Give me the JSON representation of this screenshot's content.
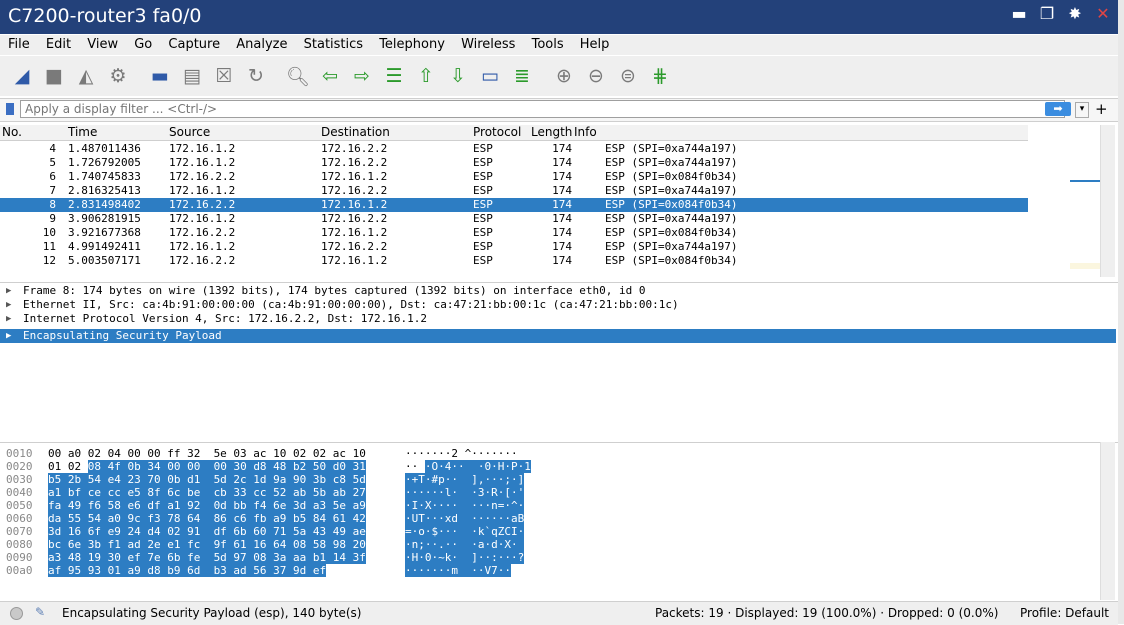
{
  "window": {
    "title": "C7200-router3 fa0/0"
  },
  "menu": [
    "File",
    "Edit",
    "View",
    "Go",
    "Capture",
    "Analyze",
    "Statistics",
    "Telephony",
    "Wireless",
    "Tools",
    "Help"
  ],
  "filter": {
    "placeholder": "Apply a display filter ... <Ctrl-/>"
  },
  "columns": {
    "no": "No.",
    "time": "Time",
    "source": "Source",
    "destination": "Destination",
    "protocol": "Protocol",
    "length": "Length",
    "info": "Info"
  },
  "packets": [
    {
      "no": "4",
      "time": "1.487011436",
      "src": "172.16.1.2",
      "dst": "172.16.2.2",
      "proto": "ESP",
      "len": "174",
      "info": "ESP (SPI=0xa744a197)"
    },
    {
      "no": "5",
      "time": "1.726792005",
      "src": "172.16.1.2",
      "dst": "172.16.2.2",
      "proto": "ESP",
      "len": "174",
      "info": "ESP (SPI=0xa744a197)"
    },
    {
      "no": "6",
      "time": "1.740745833",
      "src": "172.16.2.2",
      "dst": "172.16.1.2",
      "proto": "ESP",
      "len": "174",
      "info": "ESP (SPI=0x084f0b34)"
    },
    {
      "no": "7",
      "time": "2.816325413",
      "src": "172.16.1.2",
      "dst": "172.16.2.2",
      "proto": "ESP",
      "len": "174",
      "info": "ESP (SPI=0xa744a197)"
    },
    {
      "no": "8",
      "time": "2.831498402",
      "src": "172.16.2.2",
      "dst": "172.16.1.2",
      "proto": "ESP",
      "len": "174",
      "info": "ESP (SPI=0x084f0b34)"
    },
    {
      "no": "9",
      "time": "3.906281915",
      "src": "172.16.1.2",
      "dst": "172.16.2.2",
      "proto": "ESP",
      "len": "174",
      "info": "ESP (SPI=0xa744a197)"
    },
    {
      "no": "10",
      "time": "3.921677368",
      "src": "172.16.2.2",
      "dst": "172.16.1.2",
      "proto": "ESP",
      "len": "174",
      "info": "ESP (SPI=0x084f0b34)"
    },
    {
      "no": "11",
      "time": "4.991492411",
      "src": "172.16.1.2",
      "dst": "172.16.2.2",
      "proto": "ESP",
      "len": "174",
      "info": "ESP (SPI=0xa744a197)"
    },
    {
      "no": "12",
      "time": "5.003507171",
      "src": "172.16.2.2",
      "dst": "172.16.1.2",
      "proto": "ESP",
      "len": "174",
      "info": "ESP (SPI=0x084f0b34)"
    }
  ],
  "details": [
    "Frame 8: 174 bytes on wire (1392 bits), 174 bytes captured (1392 bits) on interface eth0, id 0",
    "Ethernet II, Src: ca:4b:91:00:00:00 (ca:4b:91:00:00:00), Dst: ca:47:21:bb:00:1c (ca:47:21:bb:00:1c)",
    "Internet Protocol Version 4, Src: 172.16.2.2, Dst: 172.16.1.2",
    "Encapsulating Security Payload"
  ],
  "hex": [
    {
      "off": "0010",
      "pre": "00 a0 02 04 00 00 ff 32  5e 03 ac 10 02 02 ac 10",
      "hl": "",
      "apre": "·······2 ^·······",
      "ahl": ""
    },
    {
      "off": "0020",
      "pre": "01 02 ",
      "hl": "08 4f 0b 34 00 00  00 30 d8 48 b2 50 d0 31",
      "apre": "·· ",
      "ahl": "·O·4··  ·0·H·P·1"
    },
    {
      "off": "0030",
      "pre": "",
      "hl": "b5 2b 54 e4 23 70 0b d1  5d 2c 1d 9a 90 3b c8 5d",
      "apre": "",
      "ahl": "·+T·#p··  ],···;·]"
    },
    {
      "off": "0040",
      "pre": "",
      "hl": "a1 bf ce cc e5 8f 6c be  cb 33 cc 52 ab 5b ab 27",
      "apre": "",
      "ahl": "······l·  ·3·R·[·'"
    },
    {
      "off": "0050",
      "pre": "",
      "hl": "fa 49 f6 58 e6 df a1 92  0d bb f4 6e 3d a3 5e a9",
      "apre": "",
      "ahl": "·I·X····  ···n=·^·"
    },
    {
      "off": "0060",
      "pre": "",
      "hl": "da 55 54 a0 9c f3 78 64  86 c6 fb a9 b5 84 61 42",
      "apre": "",
      "ahl": "·UT···xd  ······aB"
    },
    {
      "off": "0070",
      "pre": "",
      "hl": "3d 16 6f e9 24 d4 02 91  df 6b 60 71 5a 43 49 ae",
      "apre": "",
      "ahl": "=·o·$···  ·k`qZCI·"
    },
    {
      "off": "0080",
      "pre": "",
      "hl": "bc 6e 3b f1 ad 2e e1 fc  9f 61 16 64 08 58 98 20",
      "apre": "",
      "ahl": "·n;··.··  ·a·d·X· "
    },
    {
      "off": "0090",
      "pre": "",
      "hl": "a3 48 19 30 ef 7e 6b fe  5d 97 08 3a aa b1 14 3f",
      "apre": "",
      "ahl": "·H·0·~k·  ]··:···?"
    },
    {
      "off": "00a0",
      "pre": "",
      "hl": "af 95 93 01 a9 d8 b9 6d  b3 ad 56 37 9d ef",
      "apre": "",
      "ahl": "·······m  ··V7··"
    }
  ],
  "status": {
    "message": "Encapsulating Security Payload (esp), 140 byte(s)",
    "packets": "Packets: 19 · Displayed: 19 (100.0%) · Dropped: 0 (0.0%)",
    "profile": "Profile: Default"
  },
  "colors": {
    "selection": "#2d7dc3",
    "titlebar": "#23417a"
  }
}
